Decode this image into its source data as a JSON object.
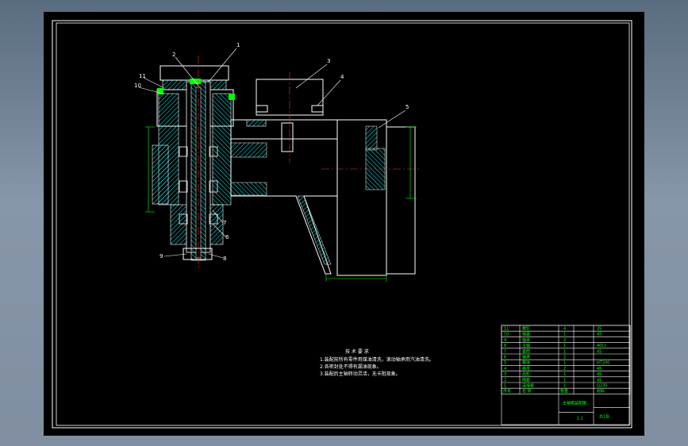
{
  "viewport": {
    "background": "#000000"
  },
  "colors": {
    "frame": "#ffffff",
    "outline": "#ffffff",
    "hatch": "#00ffff",
    "dimension": "#00ff00",
    "leader": "#ffffff",
    "centerline": "#ff3030",
    "bearing": "#d4d4d4",
    "table_line": "#ffffff",
    "table_text": "#00ff00"
  },
  "part_numbers": [
    "1",
    "2",
    "3",
    "4",
    "5",
    "6",
    "7",
    "8",
    "9",
    "10",
    "11"
  ],
  "tech_requirements": {
    "title": "技 术 要 求",
    "lines": [
      "1.装配前所有零件用煤油清洗，滚动轴承用汽油清洗。",
      "2.各密封处不得有漏油现象。",
      "3.装配后主轴转动灵活，无卡阻现象。"
    ]
  },
  "title_block": {
    "rows": [
      {
        "no": "11",
        "name": "螺钉",
        "qty": "4",
        "mat": "35"
      },
      {
        "no": "10",
        "name": "端盖",
        "qty": "1",
        "mat": "45"
      },
      {
        "no": "9",
        "name": "轴承",
        "qty": "2",
        "mat": ""
      },
      {
        "no": "8",
        "name": "主轴",
        "qty": "1",
        "mat": "40Cr"
      },
      {
        "no": "7",
        "name": "套筒",
        "qty": "1",
        "mat": "45"
      },
      {
        "no": "6",
        "name": "轴承",
        "qty": "2",
        "mat": ""
      },
      {
        "no": "5",
        "name": "箱体",
        "qty": "1",
        "mat": "HT200"
      },
      {
        "no": "4",
        "name": "螺母",
        "qty": "2",
        "mat": "45"
      },
      {
        "no": "3",
        "name": "齿轮",
        "qty": "1",
        "mat": "45"
      },
      {
        "no": "2",
        "name": "隔套",
        "qty": "1",
        "mat": "45"
      },
      {
        "no": "1",
        "name": "连接板",
        "qty": "1",
        "mat": "Q235"
      }
    ],
    "header": {
      "no": "序号",
      "name": "名 称",
      "qty": "数量",
      "mat": "材料"
    },
    "drawing_name": "主轴箱装配图",
    "scale": "1:1",
    "sheet": "共1张"
  }
}
